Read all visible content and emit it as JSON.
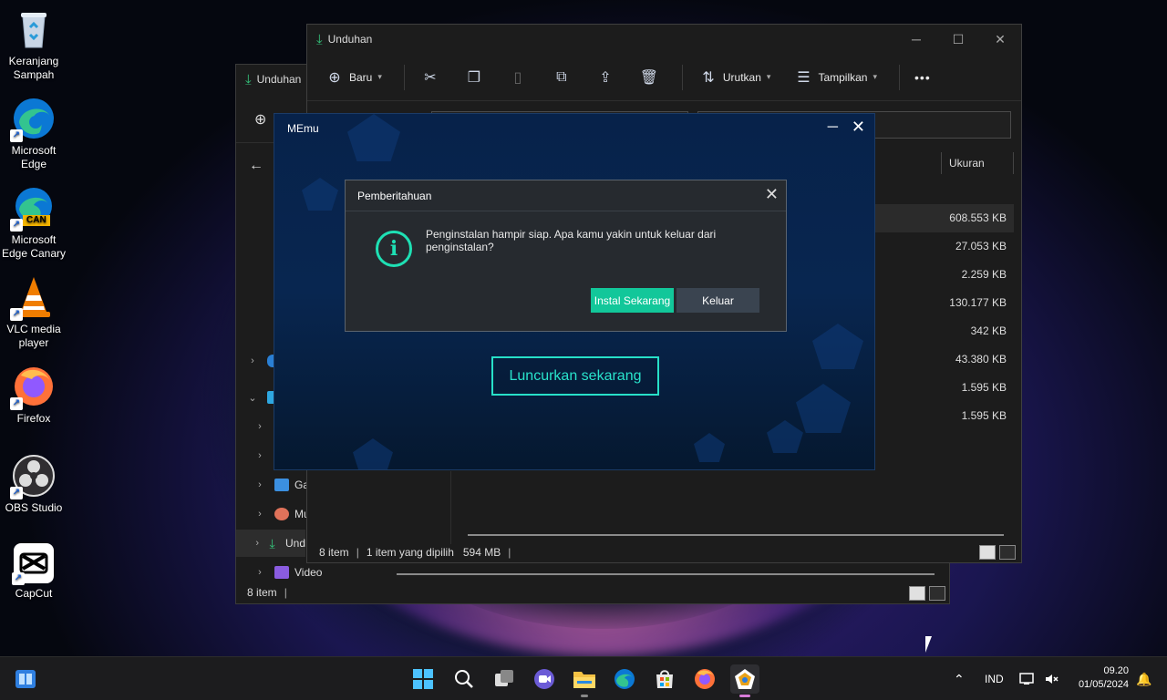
{
  "desktop": {
    "icons": [
      {
        "label": "Keranjang\nSampah",
        "l1": "Keranjang",
        "l2": "Sampah",
        "icon": "recycle-bin-icon"
      },
      {
        "l1": "Microsoft",
        "l2": "Edge",
        "icon": "edge-icon"
      },
      {
        "l1": "Microsoft",
        "l2": "Edge Canary",
        "badge": "CAN",
        "icon": "edge-canary-icon"
      },
      {
        "l1": "VLC media",
        "l2": "player",
        "icon": "vlc-icon"
      },
      {
        "l1": "Firefox",
        "l2": "",
        "icon": "firefox-icon"
      },
      {
        "l1": "OBS Studio",
        "l2": "",
        "icon": "obs-icon"
      },
      {
        "l1": "CapCut",
        "l2": "",
        "icon": "capcut-icon"
      }
    ]
  },
  "explorer_back": {
    "title": "Unduhan",
    "nav": [
      {
        "label": "Gar",
        "icon": "pictures-icon"
      },
      {
        "label": "Mu",
        "icon": "music-icon"
      },
      {
        "label": "Und",
        "icon": "downloads-icon"
      },
      {
        "label": "Video",
        "icon": "video-icon"
      }
    ],
    "status": "8 item"
  },
  "explorer_front": {
    "title": "Unduhan",
    "toolbar": {
      "new_label": "Baru",
      "sort_label": "Urutkan",
      "view_label": "Tampilkan",
      "more_label": "•••"
    },
    "column_size": "Ukuran",
    "sizes": [
      "608.553 KB",
      "27.053 KB",
      "2.259 KB",
      "130.177 KB",
      "342 KB",
      "43.380 KB",
      "1.595 KB",
      "1.595 KB"
    ],
    "status": {
      "count": "8 item",
      "selected": "1 item yang dipilih",
      "size": "594 MB"
    }
  },
  "memu": {
    "title": "MEmu",
    "launch_label": "Luncurkan sekarang",
    "accent": "#27e0c8"
  },
  "notice": {
    "title": "Pemberitahuan",
    "message": "Penginstalan hampir siap. Apa kamu yakin untuk keluar dari penginstalan?",
    "install_label": "Instal Sekarang",
    "exit_label": "Keluar",
    "install_color": "#12c79a"
  },
  "taskbar": {
    "language": "IND",
    "time": "09.20",
    "date": "01/05/2024",
    "apps": [
      "windows-start-icon",
      "search-icon",
      "task-view-icon",
      "meet-icon",
      "file-explorer-icon",
      "edge-icon",
      "store-icon",
      "firefox-icon",
      "memu-icon"
    ]
  }
}
